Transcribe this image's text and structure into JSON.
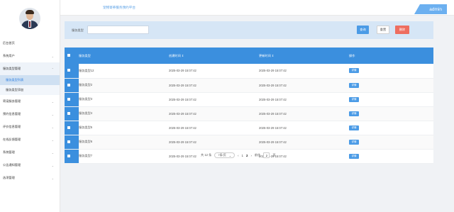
{
  "topbar": {
    "title": "宠物寄养服务预约平台",
    "user_label": "admin"
  },
  "sidebar": {
    "items": [
      {
        "label": "后台首页",
        "has_children": false
      },
      {
        "label": "系统用户",
        "has_children": true
      },
      {
        "label": "服务类型管理",
        "has_children": true,
        "open": true,
        "children": [
          {
            "label": "服务类型列表",
            "active": true
          },
          {
            "label": "服务类型添加",
            "active": false
          }
        ]
      },
      {
        "label": "寄宠服务管理",
        "has_children": true
      },
      {
        "label": "预约信息管理",
        "has_children": true
      },
      {
        "label": "评价信息管理",
        "has_children": true
      },
      {
        "label": "在线反馈管理",
        "has_children": true
      },
      {
        "label": "系统管理",
        "has_children": true
      },
      {
        "label": "公告通知管理",
        "has_children": true
      },
      {
        "label": "选项管理",
        "has_children": true
      }
    ]
  },
  "search": {
    "label": "服务类型",
    "value": "",
    "placeholder": "",
    "search_label": "查询",
    "reset_label": "重置",
    "delete_label": "删除"
  },
  "table": {
    "columns": [
      "服务类型",
      "创建时间 ⇕",
      "更新时间 ⇕",
      "操作"
    ],
    "rows": [
      {
        "type": "服务类型12",
        "created": "2025-03-29 15:07:42",
        "updated": "2025-03-29 15:07:42",
        "action": "详情"
      },
      {
        "type": "服务类型2",
        "created": "2025-03-29 15:07:42",
        "updated": "2025-03-29 15:07:42",
        "action": "详情"
      },
      {
        "type": "服务类型3",
        "created": "2025-03-29 15:07:42",
        "updated": "2025-03-29 15:07:42",
        "action": "详情"
      },
      {
        "type": "服务类型4",
        "created": "2025-03-29 15:07:42",
        "updated": "2025-03-29 15:07:42",
        "action": "详情"
      },
      {
        "type": "服务类型5",
        "created": "2025-03-29 15:07:42",
        "updated": "2025-03-29 15:07:42",
        "action": "详情"
      },
      {
        "type": "服务类型6",
        "created": "2025-03-29 15:07:42",
        "updated": "2025-03-29 15:07:42",
        "action": "详情"
      },
      {
        "type": "服务类型7",
        "created": "2025-03-29 15:07:42",
        "updated": "2025-03-29 15:07:42",
        "action": "详情"
      }
    ]
  },
  "pagination": {
    "total": "共 12 条",
    "page_size": "7条/页",
    "prev": "‹",
    "pages": [
      "1",
      "2"
    ],
    "current": "2",
    "next": "›",
    "goto_label": "前往",
    "goto_value": "2",
    "goto_suffix": "页"
  },
  "colors": {
    "accent": "#3b8fde",
    "search_panel": "#d6e6f6",
    "delete": "#ee6e60"
  }
}
